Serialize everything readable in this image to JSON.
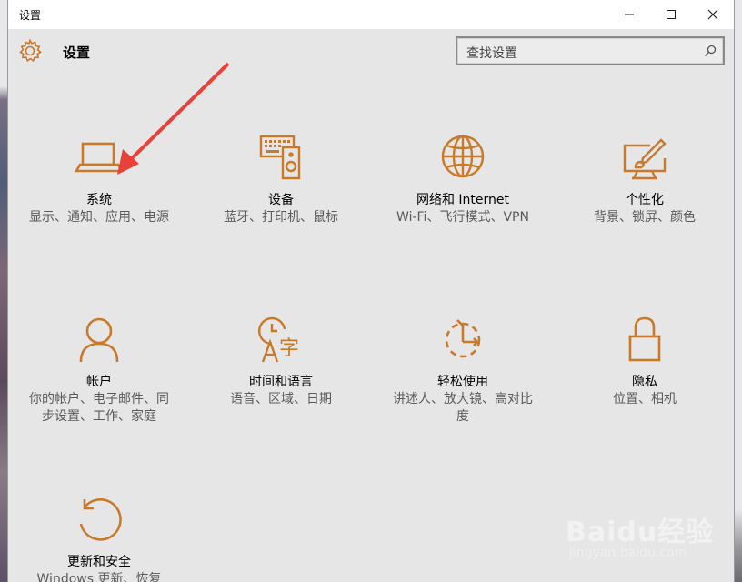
{
  "window": {
    "title": "设置",
    "minimize_glyph": "—",
    "maximize_glyph": "☐",
    "close_glyph": "✕"
  },
  "header": {
    "app_title": "设置",
    "search_placeholder": "查找设置"
  },
  "accent_color": "#c8792a",
  "tiles": [
    {
      "label": "系统",
      "desc": "显示、通知、应用、电源",
      "icon": "laptop-icon"
    },
    {
      "label": "设备",
      "desc": "蓝牙、打印机、鼠标",
      "icon": "devices-icon"
    },
    {
      "label": "网络和 Internet",
      "desc": "Wi-Fi、飞行模式、VPN",
      "icon": "globe-icon"
    },
    {
      "label": "个性化",
      "desc": "背景、锁屏、颜色",
      "icon": "personalization-icon"
    },
    {
      "label": "帐户",
      "desc": "你的帐户、电子邮件、同步设置、工作、家庭",
      "icon": "person-icon"
    },
    {
      "label": "时间和语言",
      "desc": "语音、区域、日期",
      "icon": "time-language-icon"
    },
    {
      "label": "轻松使用",
      "desc": "讲述人、放大镜、高对比度",
      "icon": "ease-of-access-icon"
    },
    {
      "label": "隐私",
      "desc": "位置、相机",
      "icon": "lock-icon"
    },
    {
      "label": "更新和安全",
      "desc": "Windows 更新、恢复",
      "icon": "update-icon"
    }
  ],
  "watermark": {
    "brand": "Baidu经验",
    "url": "jingyan.baidu.com"
  }
}
